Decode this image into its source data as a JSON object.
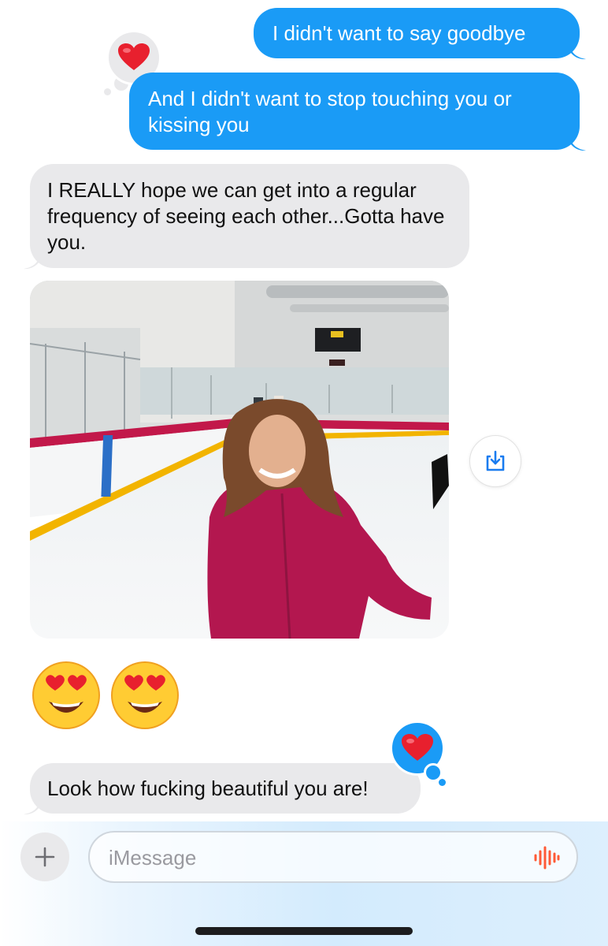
{
  "conversation": {
    "messages": [
      {
        "direction": "sent",
        "text": "I didn't want to say goodbye"
      },
      {
        "direction": "sent",
        "text": "And I didn't want to stop touching you or kissing you",
        "reaction": "heart"
      },
      {
        "direction": "received",
        "text": "I REALLY hope we can get into a regular frequency of seeing each other...Gotta have you."
      },
      {
        "direction": "received",
        "type": "photo",
        "description_icon": "photo-attachment"
      },
      {
        "direction": "received",
        "type": "emoji",
        "text": "😍😍"
      },
      {
        "direction": "received",
        "text": "Look how fucking beautiful you are!",
        "reaction": "heart"
      }
    ]
  },
  "compose": {
    "placeholder": "iMessage",
    "value": ""
  },
  "icons": {
    "reaction": "heart-icon",
    "save": "save-download-icon",
    "plus": "plus-icon",
    "audio": "audio-waveform-icon"
  },
  "colors": {
    "sent_bubble": "#1a9bf6",
    "received_bubble": "#e9e9eb",
    "heart": "#e8202e",
    "audio": "#ff5a36"
  }
}
